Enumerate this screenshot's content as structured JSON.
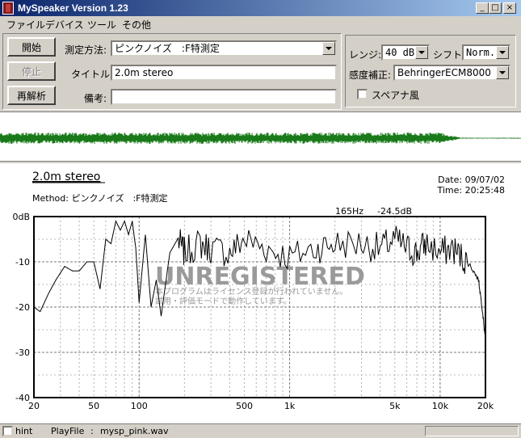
{
  "window": {
    "title": "MySpeaker Version 1.23"
  },
  "menu": [
    "ファイル",
    "デバイス",
    "ツール",
    "その他"
  ],
  "buttons": {
    "start": "開始",
    "stop": "停止",
    "reanalyze": "再解析"
  },
  "form": {
    "method_label": "測定方法:",
    "method_value": "ピンクノイズ　:F特測定",
    "title_label": "タイトル:",
    "title_value": "2.0m stereo",
    "memo_label": "備考:",
    "memo_value": ""
  },
  "settings": {
    "range_label": "レンジ:",
    "range_value": "40 dB",
    "shift_label": "シフト:",
    "shift_value": "Norm.",
    "cal_label": "感度補正:",
    "cal_value": "BehringerECM8000",
    "specana_label": "スペアナ風"
  },
  "graph": {
    "title": "2.0m stereo",
    "method_line": "Method:  ピンクノイズ　:F特測定",
    "date": "Date: 09/07/02",
    "time": "Time: 20:25:48",
    "cursor_freq": "165Hz",
    "cursor_level": "-24.5dB",
    "watermark": "UNREGISTERED",
    "watermark_line1": "本プログラムはライセンス登録が行われていません。",
    "watermark_line2": "試用・評価モードで動作しています。",
    "line_color": "#000000",
    "wave_color": "#1a7a1a"
  },
  "chart_data": {
    "type": "line",
    "xscale": "log",
    "xlim": [
      20,
      20000
    ],
    "ylim": [
      -40,
      0
    ],
    "xticks": [
      20,
      50,
      100,
      500,
      1000,
      5000,
      10000,
      20000
    ],
    "xtick_labels": [
      "20",
      "50",
      "100",
      "500",
      "1k",
      "5k",
      "10k",
      "20k"
    ],
    "yticks": [
      0,
      -10,
      -20,
      -30,
      -40
    ],
    "ytick_labels": [
      "0dB",
      "-10",
      "-20",
      "-30",
      "-40"
    ],
    "series": [
      {
        "x": [
          20,
          22,
          25,
          28,
          32,
          36,
          40,
          45,
          50,
          55,
          60,
          65,
          70,
          75,
          80,
          85,
          90,
          95,
          100,
          110,
          120,
          130,
          140,
          160,
          180,
          200,
          250,
          300,
          400,
          500,
          700,
          1000,
          1500,
          2000,
          3000,
          4000,
          5000,
          6000,
          7000,
          8000,
          10000,
          12000,
          14000,
          16000,
          18000,
          19000,
          20000
        ],
        "y": [
          -20,
          -21,
          -17,
          -14,
          -11,
          -12,
          -12,
          -10,
          -10,
          -16,
          -5,
          -6,
          -1,
          -3,
          -1,
          -4,
          -1,
          -7,
          -19,
          -4,
          -20,
          -14,
          -22,
          -8,
          -5,
          -8,
          -6,
          -7,
          -8,
          -5,
          -7,
          -9,
          -7,
          -6,
          -6,
          -7,
          -5,
          -7,
          -8,
          -6,
          -8,
          -7,
          -9,
          -11,
          -14,
          -20,
          -27
        ]
      }
    ]
  },
  "status": {
    "hint_label": "hint",
    "playfile_label": "PlayFile",
    "playfile_sep": ":",
    "playfile_value": "mysp_pink.wav"
  }
}
